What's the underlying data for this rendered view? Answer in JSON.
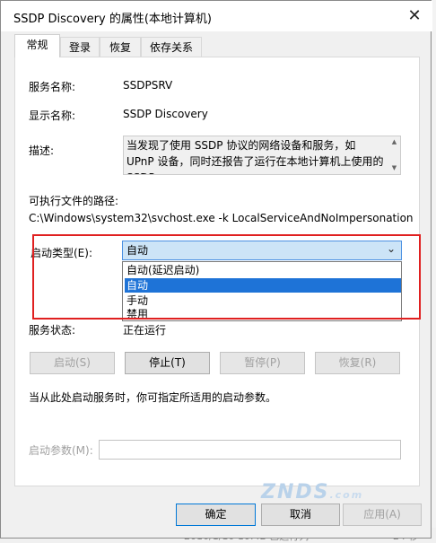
{
  "window": {
    "title": "SSDP Discovery 的属性(本地计算机)",
    "close_glyph": "✕"
  },
  "tabs": [
    "常规",
    "登录",
    "恢复",
    "依存关系"
  ],
  "general": {
    "service_name_label": "服务名称:",
    "service_name_value": "SSDPSRV",
    "display_name_label": "显示名称:",
    "display_name_value": "SSDP Discovery",
    "description_label": "描述:",
    "description_value": "当发现了使用 SSDP 协议的网络设备和服务，如 UPnP 设备，同时还报告了运行在本地计算机上使用的 SSDP",
    "path_label": "可执行文件的路径:",
    "path_value": "C:\\Windows\\system32\\svchost.exe -k LocalServiceAndNoImpersonation",
    "startup_type_label": "启动类型(E):",
    "startup_type_value": "自动",
    "startup_options": [
      "自动(延迟启动)",
      "自动",
      "手动",
      "禁用"
    ],
    "status_label": "服务状态:",
    "status_value": "正在运行",
    "buttons": {
      "start": "启动(S)",
      "stop": "停止(T)",
      "pause": "暂停(P)",
      "resume": "恢复(R)"
    },
    "hint": "当从此处启动服务时，你可指定所适用的启动参数。",
    "params_label": "启动参数(M):"
  },
  "footer": {
    "ok": "确定",
    "cancel": "取消",
    "apply": "应用(A)"
  },
  "background": {
    "bottom_text": "2016/1/10 10:42    已运行列",
    "right_text": "24 秒"
  },
  "watermark": "ZNDS.com",
  "colors": {
    "highlight_red": "#e02020",
    "selection_blue": "#1e73d7",
    "select_bg": "#cce4f7"
  }
}
